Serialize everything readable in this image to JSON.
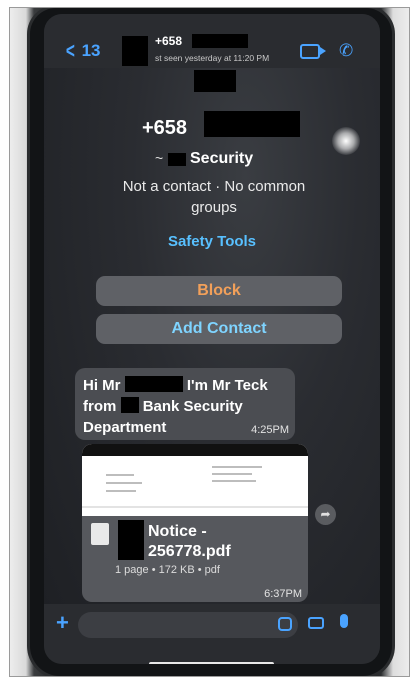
{
  "header": {
    "back_count": "13",
    "number_partial": "+658",
    "last_seen": "st seen yesterday at 11:20 PM"
  },
  "contact": {
    "number_partial": "+658",
    "name_prefix": "~",
    "name_suffix": "Security",
    "status": "Not a contact · No common groups",
    "safety_tools": "Safety Tools",
    "block_label": "Block",
    "add_contact_label": "Add Contact"
  },
  "messages": [
    {
      "line1_a": "Hi Mr",
      "line1_b": "I'm Mr Teck",
      "line2_a": "from",
      "line2_b": "Bank Security",
      "line3": "Department",
      "time": "4:25PM"
    },
    {
      "file_line1": "Notice -",
      "file_line2": "256778.pdf",
      "file_meta": "1 page • 172 KB • pdf",
      "time": "6:37PM"
    }
  ],
  "colors": {
    "accent": "#4aa3ff",
    "block": "#f2a05a",
    "add_contact": "#7fd4ff"
  }
}
